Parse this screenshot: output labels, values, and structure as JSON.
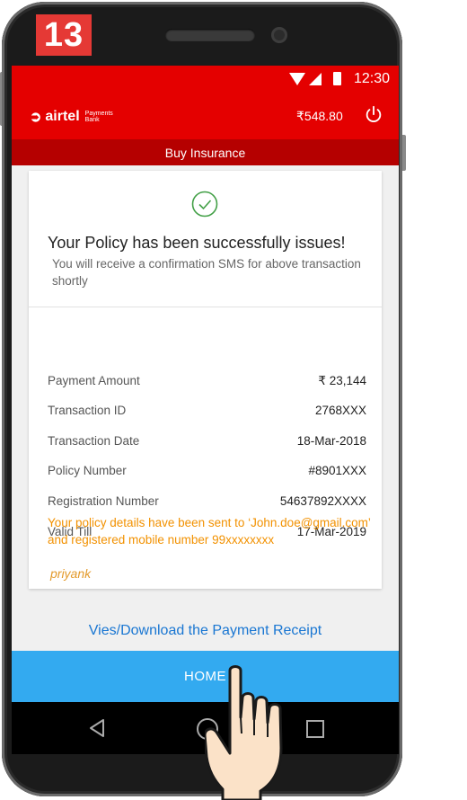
{
  "tutorial": {
    "step_number": "13"
  },
  "status_bar": {
    "time": "12:30"
  },
  "app_bar": {
    "brand_name": "airtel",
    "brand_subtitle_line1": "Payments",
    "brand_subtitle_line2": "Bank",
    "balance": "₹548.80"
  },
  "page": {
    "title": "Buy Insurance"
  },
  "success": {
    "title": "Your Policy has been successfully issues!",
    "message": "You will receive a confirmation SMS for above transaction shortly"
  },
  "details": [
    {
      "label": "Payment Amount",
      "value": "₹ 23,144"
    },
    {
      "label": "Transaction ID",
      "value": "2768XXX"
    },
    {
      "label": "Transaction Date",
      "value": "18-Mar-2018"
    },
    {
      "label": "Policy Number",
      "value": "#8901XXX"
    },
    {
      "label": "Registration Number",
      "value": "54637892XXXX"
    },
    {
      "label": "Valid Till",
      "value": "17-Mar-2019"
    }
  ],
  "note": "Your policy details have been sent to ‘John.doe@gmail.com’ and registered mobile number 99xxxxxxxx",
  "signature": "priyank",
  "receipt_link": "Vies/Download the Payment Receipt",
  "home_button": "HOME",
  "colors": {
    "brand_red": "#e40000",
    "sub_header_red": "#b50000",
    "success_green": "#43a047",
    "note_orange": "#f29100",
    "link_blue": "#1976d2",
    "button_blue": "#33aaf0",
    "badge_red": "#e53935"
  },
  "icons": [
    "wifi-icon",
    "signal-icon",
    "battery-icon",
    "power-icon",
    "check-circle-icon",
    "back-icon",
    "home-nav-icon",
    "recent-apps-icon",
    "pointing-hand-icon"
  ]
}
